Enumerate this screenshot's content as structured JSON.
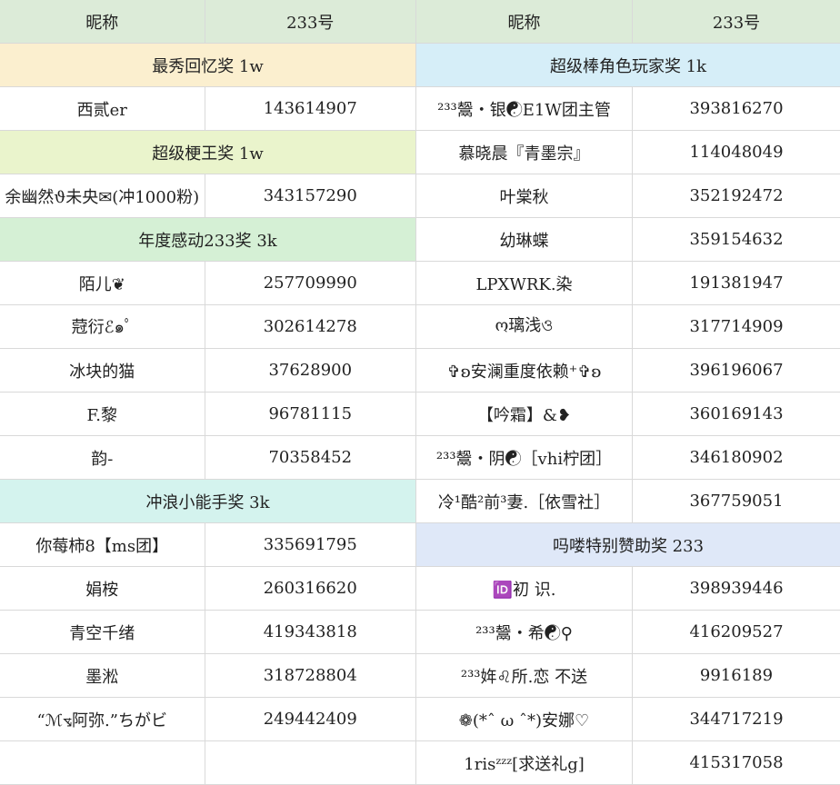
{
  "header": {
    "nickname": "昵称",
    "id_label": "233号"
  },
  "left": [
    {
      "type": "award",
      "label": "最秀回忆奖 1w",
      "color": "#fbefcf"
    },
    {
      "type": "entry",
      "name": "西贰er",
      "id": "143614907"
    },
    {
      "type": "award",
      "label": "超级梗王奖 1w",
      "color": "#eaf4cc"
    },
    {
      "type": "entry",
      "name": "余幽然ϑ未央✉(冲1000粉)",
      "id": "343157290"
    },
    {
      "type": "award",
      "label": "年度感动233奖 3k",
      "color": "#d5f0d5"
    },
    {
      "type": "entry",
      "name": "陌儿❦",
      "id": "257709990"
    },
    {
      "type": "entry",
      "name": "蒄衍ℰ๑ﾟ",
      "id": "302614278"
    },
    {
      "type": "entry",
      "name": "冰块的猫",
      "id": "37628900"
    },
    {
      "type": "entry",
      "name": "F.黎",
      "id": "96781115"
    },
    {
      "type": "entry",
      "name": "韵-",
      "id": "70358452"
    },
    {
      "type": "award",
      "label": "冲浪小能手奖 3k",
      "color": "#d4f3ee"
    },
    {
      "type": "entry",
      "name": "你莓柿8【ms团】",
      "id": "335691795"
    },
    {
      "type": "entry",
      "name": "娟桉",
      "id": "260316620"
    },
    {
      "type": "entry",
      "name": "青空千绪",
      "id": "419343818"
    },
    {
      "type": "entry",
      "name": "墨淞",
      "id": "318728804"
    },
    {
      "type": "entry",
      "name": "“ℳ⦪阿弥.”ちがビ",
      "id": "249442409"
    },
    {
      "type": "entry",
      "name": "",
      "id": ""
    }
  ],
  "right": [
    {
      "type": "award",
      "label": "超级棒角色玩家奖 1k",
      "color": "#d6eef8"
    },
    {
      "type": "entry",
      "name": "²³³鬶・银☯E1W团主管",
      "id": "393816270"
    },
    {
      "type": "entry",
      "name": "慕晓晨『青墨宗』",
      "id": "114048049"
    },
    {
      "type": "entry",
      "name": "叶棠秋",
      "id": "352192472"
    },
    {
      "type": "entry",
      "name": "幼琳蝶",
      "id": "359154632"
    },
    {
      "type": "entry",
      "name": "LPXWRK.染",
      "id": "191381947"
    },
    {
      "type": "entry",
      "name": "ო璃浅ও",
      "id": "317714909"
    },
    {
      "type": "entry",
      "name": "✞ʚ安澜重度依赖⁺✞ʚ",
      "id": "396196067"
    },
    {
      "type": "entry",
      "name": "【吟霜】&❥",
      "id": "360169143"
    },
    {
      "type": "entry",
      "name": "²³³鬶・阴☯［vhi柠团］",
      "id": "346180902"
    },
    {
      "type": "entry",
      "name": "冷¹酷²前³妻.［依雪社］",
      "id": "367759051"
    },
    {
      "type": "award",
      "label": "吗喽特别赞助奖 233",
      "color": "#dfe8f8"
    },
    {
      "type": "entry",
      "name": "🆔初 识.",
      "id": "398939446"
    },
    {
      "type": "entry",
      "name": "²³³鬶・希☯⚲",
      "id": "416209527"
    },
    {
      "type": "entry",
      "name": "²³³姩♌︎所.恋 不送",
      "id": "9916189"
    },
    {
      "type": "entry",
      "name": "❁(*ˆ ω ˆ*)安娜♡",
      "id": "344717219"
    },
    {
      "type": "entry",
      "name": "1risᶻᶻᶻ[求送礼g]",
      "id": "415317058"
    }
  ]
}
